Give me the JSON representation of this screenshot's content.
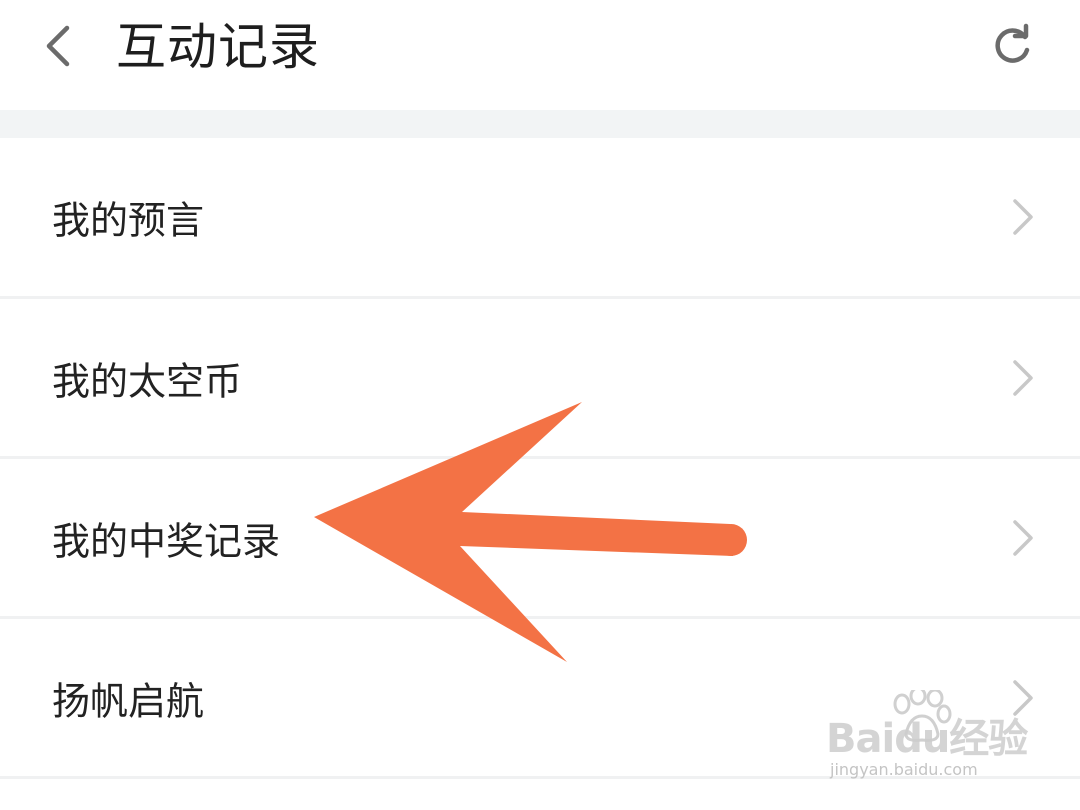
{
  "header": {
    "title": "互动记录",
    "back_icon": "chevron-left-icon",
    "refresh_icon": "refresh-icon"
  },
  "list": {
    "items": [
      {
        "label": "我的预言"
      },
      {
        "label": "我的太空币"
      },
      {
        "label": "我的中奖记录"
      },
      {
        "label": "扬帆启航"
      }
    ]
  },
  "annotation": {
    "arrow_color": "#f37245"
  },
  "watermark": {
    "brand": "Baidu经验",
    "url": "jingyan.baidu.com"
  },
  "colors": {
    "background": "#ffffff",
    "separator": "#f2f4f5",
    "text": "#222222",
    "chevron": "#c8c8c8"
  }
}
